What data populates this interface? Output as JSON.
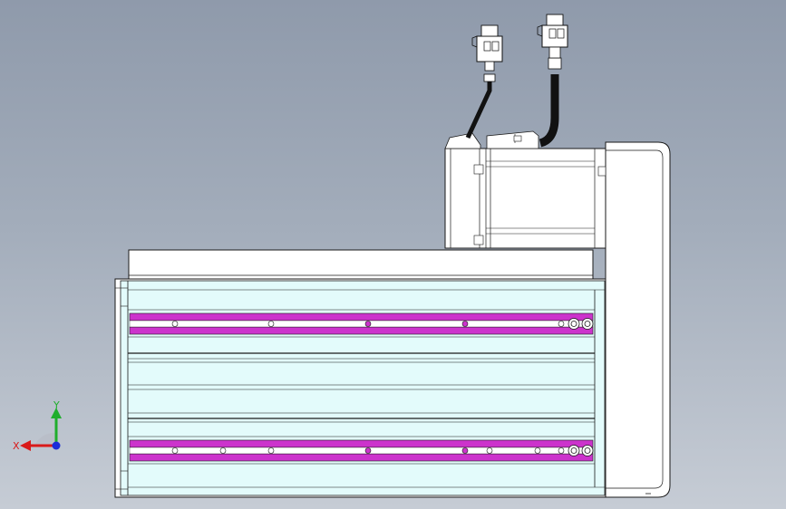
{
  "viewport": {
    "background_top": "#8f9aab",
    "background_bottom": "#c6ccd5"
  },
  "triad": {
    "x_label": "X",
    "y_label": "Y",
    "x_color": "#d91a1a",
    "y_color": "#1fae2c",
    "z_color": "#1a2bd9"
  },
  "colors": {
    "body_fill": "#e3fbfb",
    "slot_fill": "#cc33cc",
    "outline": "#1a1a1a",
    "motor_fill": "#ffffff",
    "cable": "#111111"
  }
}
